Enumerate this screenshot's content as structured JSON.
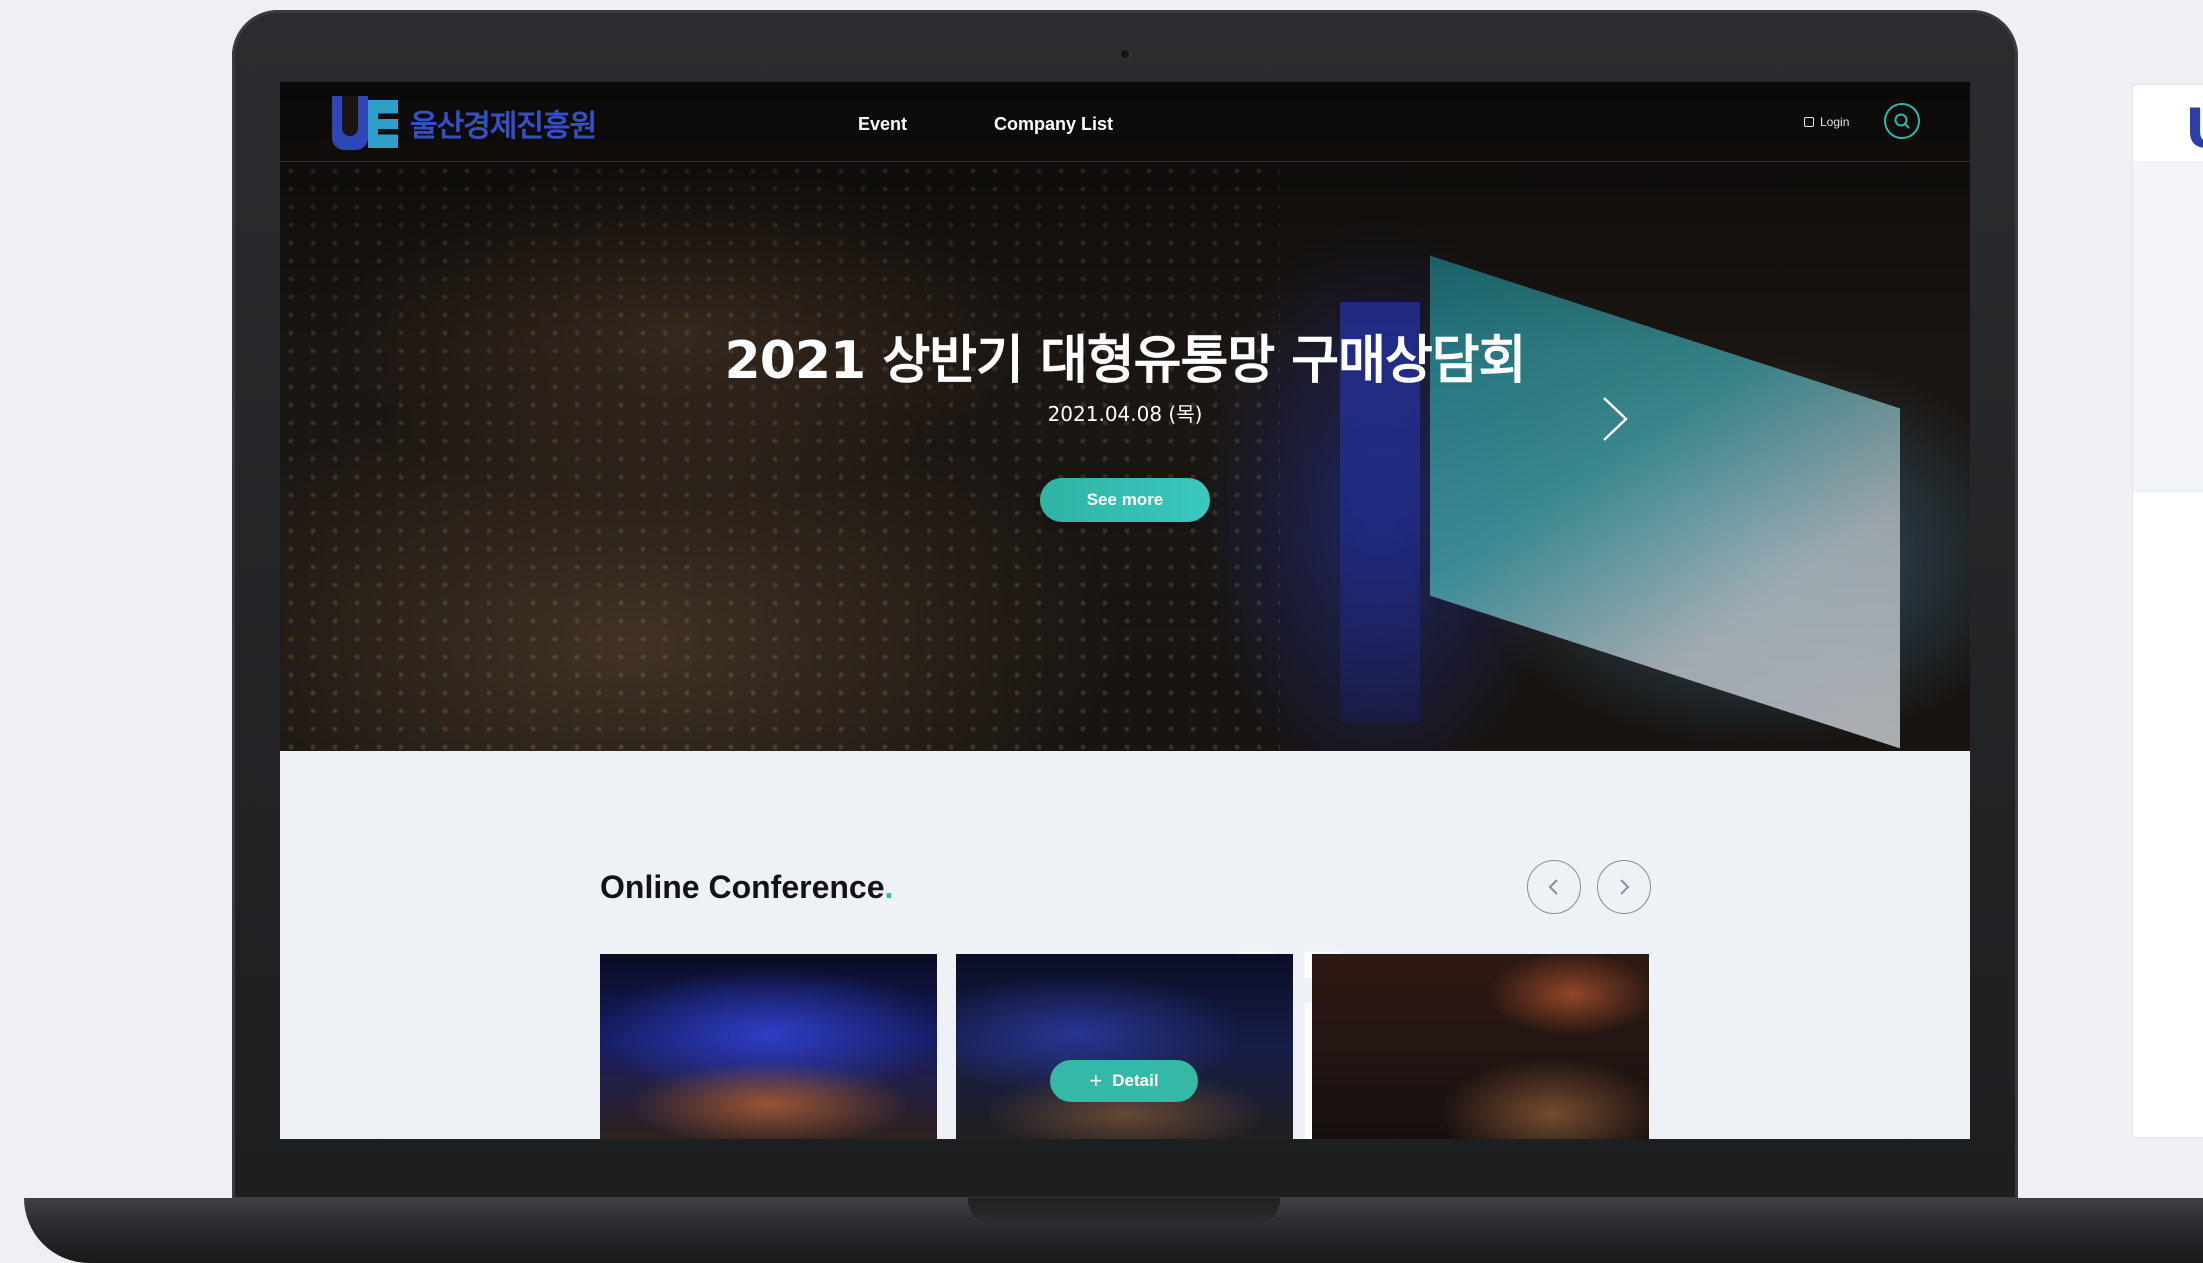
{
  "nav": {
    "logo_mark": "UE",
    "logo_text": "울산경제진흥원",
    "links": [
      "Event",
      "Company List"
    ],
    "login_label": "Login",
    "search_icon": "search-icon"
  },
  "hero": {
    "title": "2021 상반기 대형유통망 구매상담회",
    "date": "2021.04.08 (목)",
    "button_label": "See more",
    "next_icon": "chevron-right-icon"
  },
  "section": {
    "title": "Online Conference",
    "title_dot": ".",
    "watermark": "line",
    "prev_icon": "chevron-left-icon",
    "next_icon": "chevron-right-icon"
  },
  "cards": [
    {
      "image": "conference-hall-photo"
    },
    {
      "image": "conference-hall-photo",
      "detail_label": "Detail",
      "detail_icon": "plus-icon"
    },
    {
      "image": "audience-photo"
    }
  ],
  "colors": {
    "accent": "#2eb8a8",
    "brand_blue": "#2f46b7",
    "brand_cyan": "#2e9fc9",
    "title_text": "#111318",
    "background": "#eef1f5"
  }
}
